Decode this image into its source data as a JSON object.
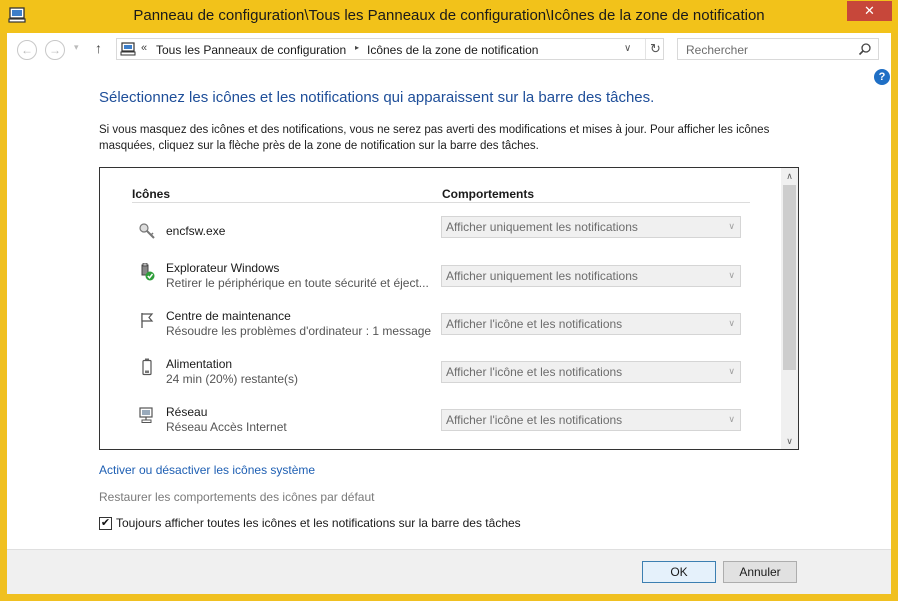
{
  "window": {
    "title": "Panneau de configuration\\Tous les Panneaux de configuration\\Icônes de la zone de notification",
    "close_glyph": "✕"
  },
  "toolbar": {
    "back_glyph": "←",
    "forward_glyph": "→",
    "dropdown_glyph": "▾",
    "up_glyph": "↑",
    "address_chevron": "«",
    "address_segments": [
      "Tous les Panneaux de configuration",
      "Icônes de la zone de notification"
    ],
    "address_separator": "▸",
    "address_dropdown_glyph": "∨",
    "refresh_glyph": "↻",
    "search_placeholder": "Rechercher",
    "help_glyph": "?"
  },
  "content": {
    "heading": "Sélectionnez les icônes et les notifications qui apparaissent sur la barre des tâches.",
    "description": "Si vous masquez des icônes et des notifications, vous ne serez pas averti des modifications et mises à jour. Pour afficher les icônes masquées, cliquez sur la flèche près de la zone de notification sur la barre des tâches.",
    "columns": {
      "icons": "Icônes",
      "behaviors": "Comportements"
    },
    "rows": [
      {
        "name": "encfsw.exe",
        "sub": "",
        "behavior": "Afficher uniquement les notifications",
        "icon": "key-icon"
      },
      {
        "name": "Explorateur Windows",
        "sub": "Retirer le périphérique en toute sécurité et éject...",
        "behavior": "Afficher uniquement les notifications",
        "icon": "usb-safe-remove-icon"
      },
      {
        "name": "Centre de maintenance",
        "sub": "Résoudre les problèmes d'ordinateur : 1 message",
        "behavior": "Afficher l'icône et les notifications",
        "icon": "flag-icon"
      },
      {
        "name": "Alimentation",
        "sub": "24 min (20%) restante(s)",
        "behavior": "Afficher l'icône et les notifications",
        "icon": "battery-icon"
      },
      {
        "name": "Réseau",
        "sub": "Réseau Accès Internet",
        "behavior": "Afficher l'icône et les notifications",
        "icon": "network-icon"
      }
    ],
    "select_arrow": "∨",
    "scroll_up": "∧",
    "scroll_down": "∨",
    "link_system_icons": "Activer ou désactiver les icônes système",
    "link_restore": "Restaurer les comportements des icônes par défaut",
    "always_show_label": "Toujours afficher toutes les icônes et les notifications sur la barre des tâches",
    "always_show_checked": true,
    "check_glyph": "✔"
  },
  "buttons": {
    "ok": "OK",
    "cancel": "Annuler"
  },
  "colors": {
    "frame": "#f0c020",
    "close": "#c7473a",
    "heading": "#1e4e99",
    "link": "#1e5fb3"
  }
}
